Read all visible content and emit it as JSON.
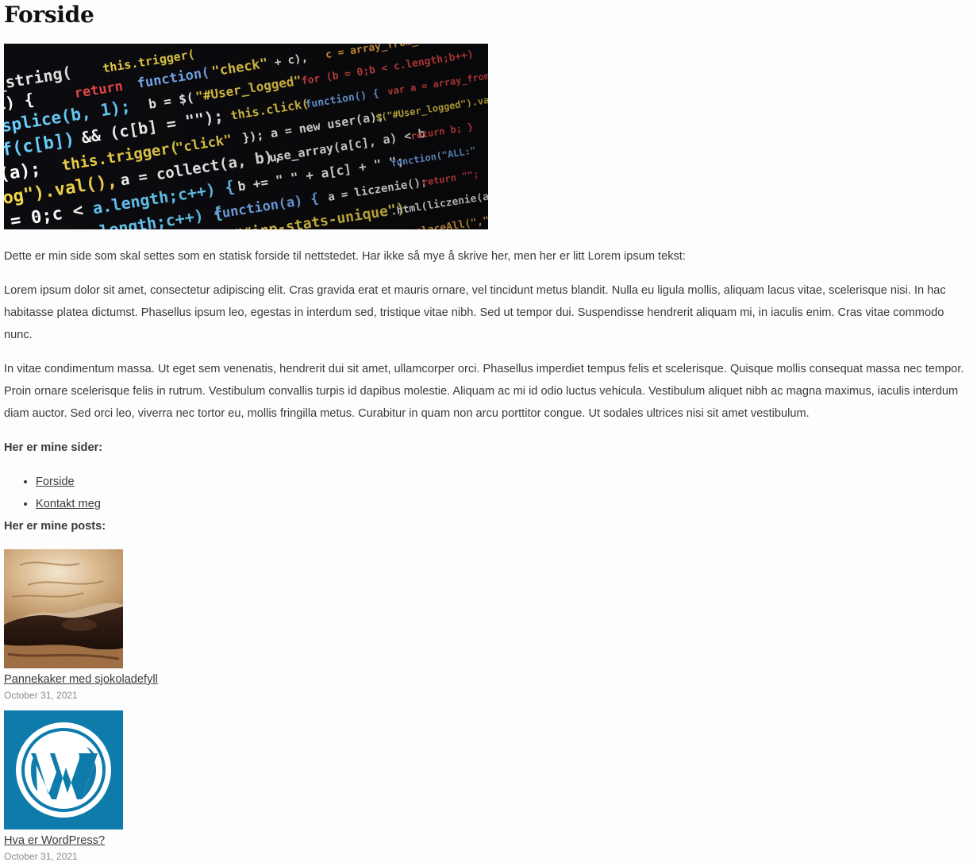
{
  "page": {
    "title": "Forside",
    "hero_image": "code-screenshot-image"
  },
  "content": {
    "intro": "Dette er min side som skal settes som en statisk forside til nettstedet. Har ikke så mye å skrive her, men her er litt Lorem ipsum tekst:",
    "lorem1": "Lorem ipsum dolor sit amet, consectetur adipiscing elit. Cras gravida erat et mauris ornare, vel tincidunt metus blandit. Nulla eu ligula mollis, aliquam lacus vitae, scelerisque nisi. In hac habitasse platea dictumst. Phasellus ipsum leo, egestas in interdum sed, tristique vitae nibh. Sed ut tempor dui. Suspendisse hendrerit aliquam mi, in iaculis enim. Cras vitae commodo nunc.",
    "lorem2": "In vitae condimentum massa. Ut eget sem venenatis, hendrerit dui sit amet, ullamcorper orci. Phasellus imperdiet tempus felis et scelerisque. Quisque mollis consequat massa nec tempor. Proin ornare scelerisque felis in rutrum. Vestibulum convallis turpis id dapibus molestie. Aliquam ac mi id odio luctus vehicula. Vestibulum aliquet nibh ac magna maximus, iaculis interdum diam auctor. Sed orci leo, viverra nec tortor eu, mollis fringilla metus. Curabitur in quam non arcu porttitor congue. Ut sodales ultrices nisi sit amet vestibulum."
  },
  "pages_section": {
    "heading": "Her er mine sider:",
    "links": [
      {
        "label": "Forside"
      },
      {
        "label": "Kontakt meg"
      }
    ]
  },
  "posts_section": {
    "heading": "Her er mine posts:",
    "posts": [
      {
        "title": "Pannekaker med sjokoladefyll",
        "date": "October 31, 2021",
        "thumb": "pancake-image"
      },
      {
        "title": "Hva er WordPress?",
        "date": "October 31, 2021",
        "thumb": "wordpress-logo"
      }
    ]
  },
  "colors": {
    "text": "#3a3a3a",
    "heading": "#111111",
    "date": "#8a8a8a",
    "wordpress_blue": "#0f7bab"
  }
}
